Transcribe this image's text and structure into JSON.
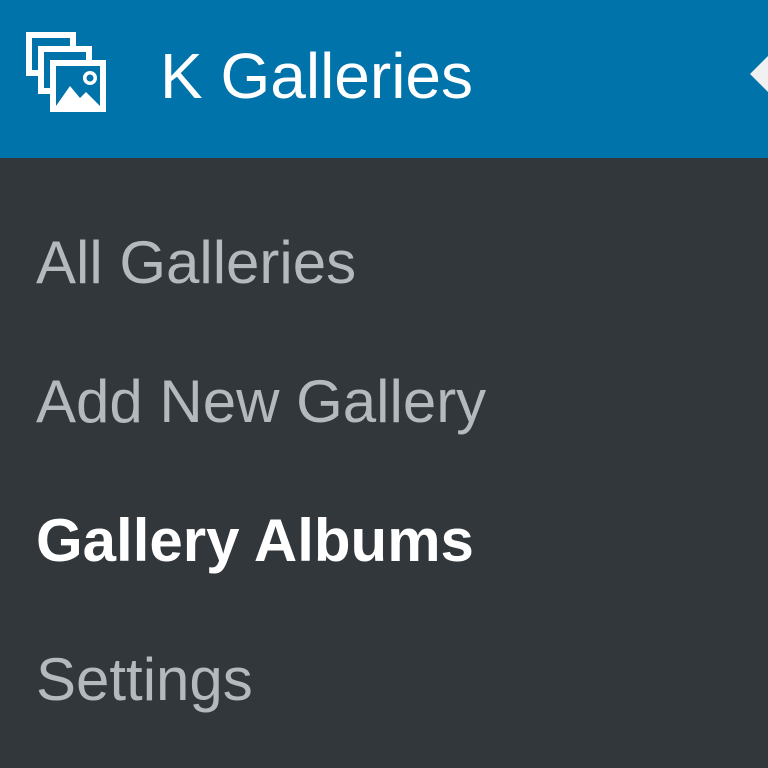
{
  "colors": {
    "header_background": "#0073aa",
    "menu_background": "#32373c",
    "item_text": "#b4b9be",
    "current_item_text": "#ffffff"
  },
  "header": {
    "icon": "gallery-icon",
    "title": "K Galleries"
  },
  "submenu": {
    "items": [
      {
        "label": "All Galleries",
        "current": false
      },
      {
        "label": "Add New Gallery",
        "current": false
      },
      {
        "label": "Gallery Albums",
        "current": true
      },
      {
        "label": "Settings",
        "current": false
      }
    ]
  }
}
